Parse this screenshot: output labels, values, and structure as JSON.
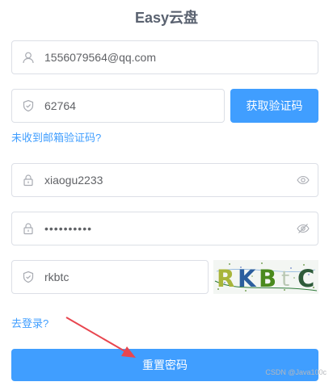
{
  "app": {
    "title": "Easy云盘"
  },
  "email": {
    "value": "1556079564@qq.com",
    "icon": "user-icon"
  },
  "verify_code": {
    "value": "62764",
    "icon": "shield-icon"
  },
  "get_code_button": {
    "label": "获取验证码"
  },
  "no_code_link": {
    "label": "未收到邮箱验证码?"
  },
  "password": {
    "value": "xiaogu2233",
    "icon": "lock-icon",
    "toggle_icon": "eye-icon"
  },
  "confirm_password": {
    "value": "••••••••••",
    "icon": "lock-icon",
    "toggle_icon": "eye-off-icon"
  },
  "captcha": {
    "value": "rkbtc",
    "icon": "shield-icon",
    "image_text": "RKBtC"
  },
  "login_link": {
    "label": "去登录?"
  },
  "reset_button": {
    "label": "重置密码"
  },
  "watermark": {
    "text": "CSDN @Java100c"
  },
  "colors": {
    "primary": "#409eff",
    "border": "#dcdfe6",
    "arrow": "#e8464f"
  }
}
